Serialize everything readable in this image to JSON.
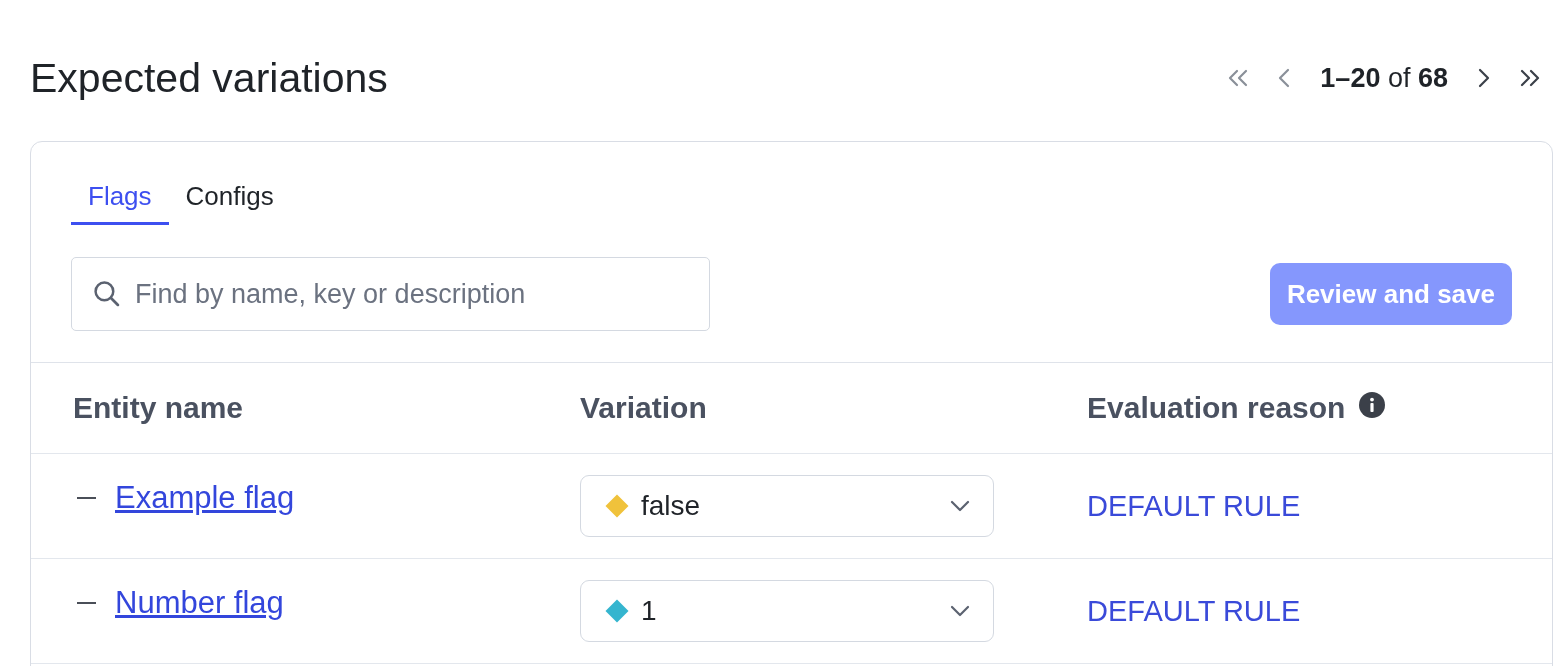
{
  "title": "Expected variations",
  "pagination": {
    "first": {
      "disabled": true
    },
    "previous": {
      "disabled": true
    },
    "range": "**1–20** of **68**",
    "next": {
      "disabled": false
    },
    "last": {
      "disabled": false
    }
  },
  "tabs": [
    {
      "label": "Flags",
      "selected": true
    },
    {
      "label": "Configs",
      "selected": false
    }
  ],
  "search": {
    "placeholder": "Find by name, key or description"
  },
  "primary_button": {
    "label": "Review and save",
    "disabled": true
  },
  "table": {
    "columns": [
      {
        "label": "Entity name",
        "info": false
      },
      {
        "label": "Variation",
        "info": false
      },
      {
        "label": "Evaluation reason",
        "info": true
      }
    ],
    "rows": [
      {
        "name": "Example flag",
        "variation": {
          "value": "false",
          "color": "#f0c23b"
        },
        "reason": "DEFAULT RULE"
      },
      {
        "name": "Number flag",
        "variation": {
          "value": "1",
          "color": "#35b5cf"
        },
        "reason": "DEFAULT RULE"
      }
    ]
  }
}
